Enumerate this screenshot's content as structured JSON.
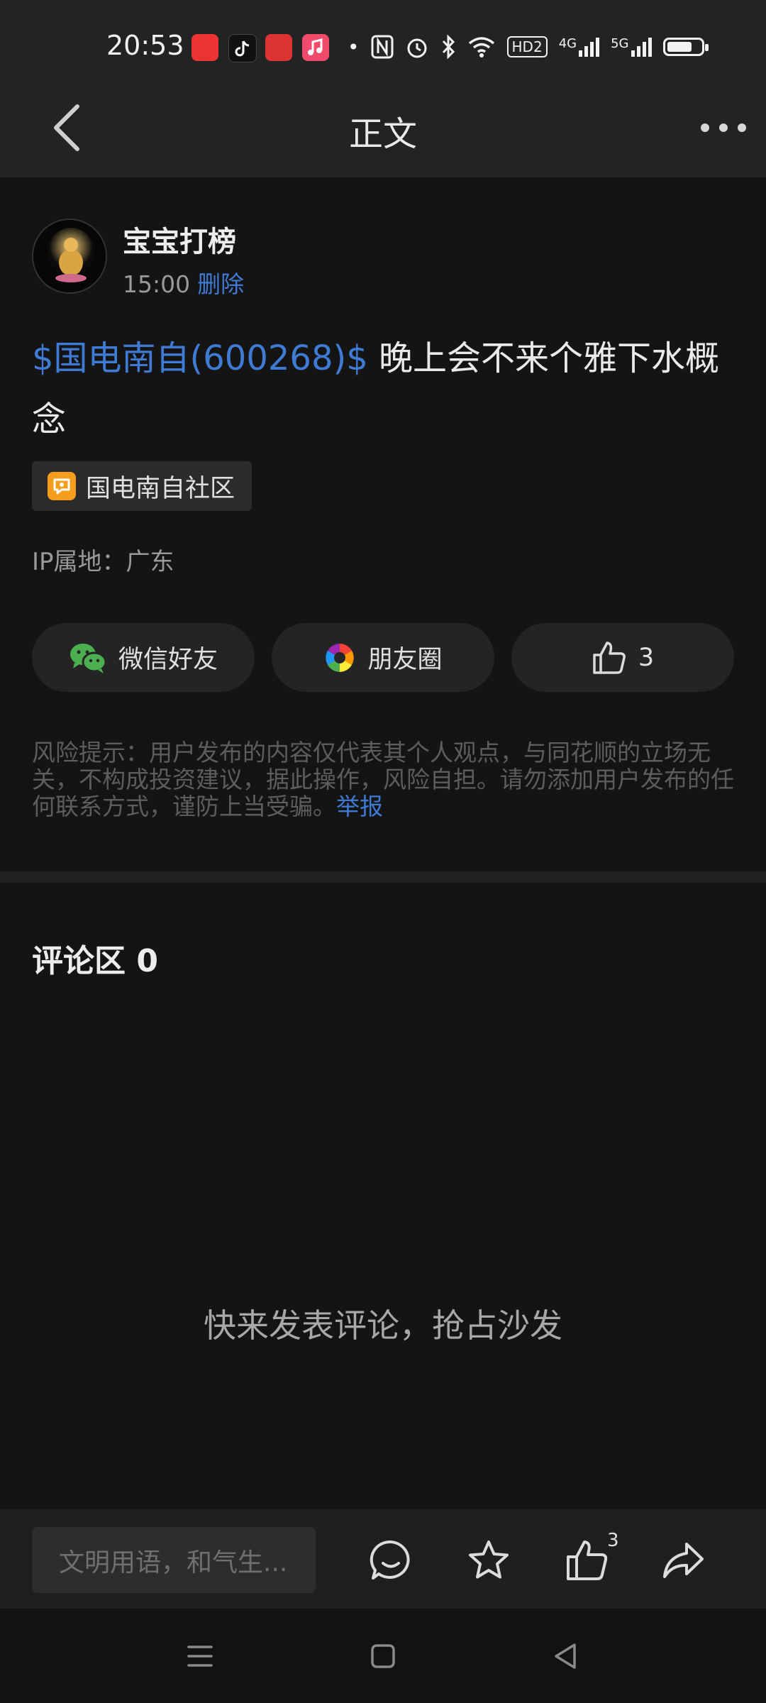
{
  "status_bar": {
    "time": "20:53",
    "network_badge": "HD2",
    "signal_1": "4G",
    "signal_2": "5G",
    "battery_level": 0.75,
    "icons": [
      "app-icon-red",
      "tiktok-icon",
      "app-icon-red-2",
      "music-icon",
      "dot-icon",
      "nfc-icon",
      "alarm-icon",
      "bluetooth-icon",
      "wifi-icon",
      "hd-icon",
      "signal-4g-icon",
      "signal-5g-icon",
      "battery-icon"
    ]
  },
  "nav": {
    "title": "正文",
    "back_icon": "chevron-left-icon",
    "more_icon": "more-horizontal-icon"
  },
  "post": {
    "author": "宝宝打榜",
    "time": "15:00",
    "delete_label": "删除",
    "stock_link": "$国电南自(600268)$",
    "text": " 晚上会不来个雅下水概念",
    "community": "国电南自社区",
    "ip_location": "IP属地：广东"
  },
  "share": {
    "wechat_label": "微信好友",
    "moments_label": "朋友圈",
    "like_count": "3"
  },
  "risk": {
    "text": "风险提示：用户发布的内容仅代表其个人观点，与同花顺的立场无关，不构成投资建议，据此操作，风险自担。请勿添加用户发布的任何联系方式，谨防上当受骗。",
    "report_label": "举报"
  },
  "comments": {
    "title": "评论区 0",
    "empty_hint": "快来发表评论，抢占沙发"
  },
  "bottom_bar": {
    "input_placeholder": "文明用语，和气生...",
    "like_count": "3"
  },
  "colors": {
    "background": "#141414",
    "bar": "#222323",
    "accent": "#3f7bd4",
    "wechat_green": "#4caf50",
    "community_orange": "#f59d1c"
  }
}
